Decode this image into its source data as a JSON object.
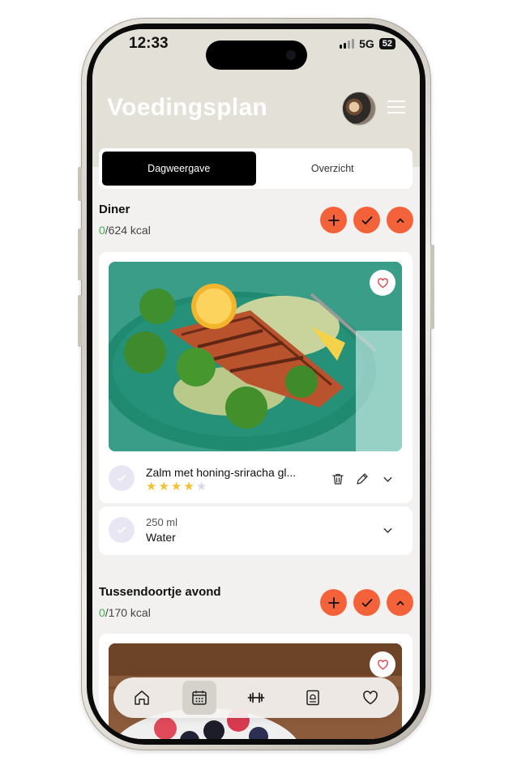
{
  "status_bar": {
    "time": "12:33",
    "network": "5G",
    "battery": "52"
  },
  "header": {
    "title": "Voedingsplan"
  },
  "tabs": [
    {
      "label": "Dagweergave",
      "active": true
    },
    {
      "label": "Overzicht",
      "active": false
    }
  ],
  "sections": [
    {
      "title": "Diner",
      "kcal_eaten": "0",
      "kcal_total": "/624 kcal",
      "meal": {
        "name": "Zalm met honing-sriracha gl...",
        "rating": 4,
        "rating_max": 5,
        "favorite": false
      },
      "drink": {
        "amount": "250 ml",
        "name": "Water"
      }
    },
    {
      "title": "Tussendoortje avond",
      "kcal_eaten": "0",
      "kcal_total": "/170 kcal"
    }
  ],
  "bottom_nav": [
    {
      "icon": "home-icon",
      "active": false
    },
    {
      "icon": "calendar-icon",
      "active": true
    },
    {
      "icon": "dumbbell-icon",
      "active": false
    },
    {
      "icon": "recipe-book-icon",
      "active": false
    },
    {
      "icon": "heart-icon",
      "active": false
    }
  ],
  "colors": {
    "accent": "#f4623a",
    "kcal_zero": "#3fb24b",
    "header_bg": "#e3e0d8",
    "star_on": "#f2c233",
    "star_off": "#d9d7ea"
  }
}
